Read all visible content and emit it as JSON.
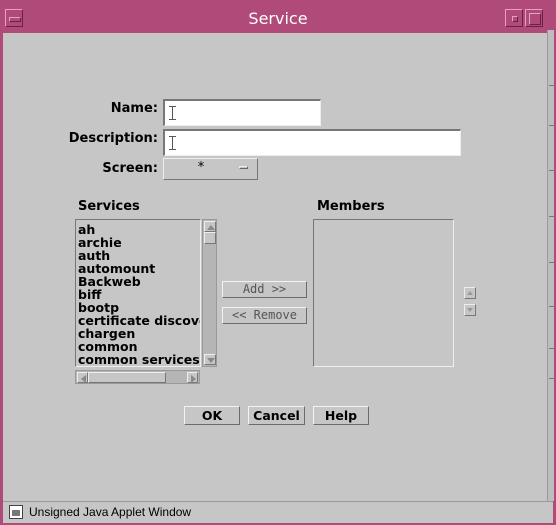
{
  "window": {
    "title": "Service"
  },
  "form": {
    "name_label": "Name:",
    "description_label": "Description:",
    "screen_label": "Screen:",
    "screen_value": "*"
  },
  "services": {
    "label": "Services",
    "items": [
      "ah",
      "archie",
      "auth",
      "automount",
      "Backweb",
      "biff",
      "bootp",
      "certificate discove",
      "chargen",
      "common",
      "common services"
    ]
  },
  "members": {
    "label": "Members",
    "items": []
  },
  "buttons": {
    "add": "Add >>",
    "remove": "<< Remove",
    "ok": "OK",
    "cancel": "Cancel",
    "help": "Help"
  },
  "status": {
    "text": "Unsigned Java Applet Window"
  },
  "colors": {
    "titlebar": "#b04a78",
    "background": "#c6c6c6"
  }
}
